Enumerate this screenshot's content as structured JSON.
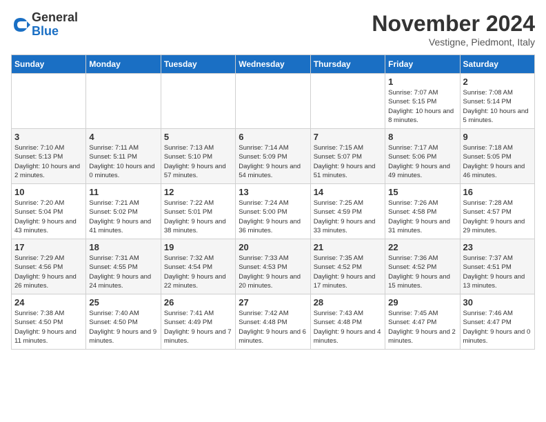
{
  "logo": {
    "general": "General",
    "blue": "Blue"
  },
  "title": "November 2024",
  "subtitle": "Vestigne, Piedmont, Italy",
  "days_of_week": [
    "Sunday",
    "Monday",
    "Tuesday",
    "Wednesday",
    "Thursday",
    "Friday",
    "Saturday"
  ],
  "weeks": [
    [
      {
        "day": "",
        "info": ""
      },
      {
        "day": "",
        "info": ""
      },
      {
        "day": "",
        "info": ""
      },
      {
        "day": "",
        "info": ""
      },
      {
        "day": "",
        "info": ""
      },
      {
        "day": "1",
        "info": "Sunrise: 7:07 AM\nSunset: 5:15 PM\nDaylight: 10 hours and 8 minutes."
      },
      {
        "day": "2",
        "info": "Sunrise: 7:08 AM\nSunset: 5:14 PM\nDaylight: 10 hours and 5 minutes."
      }
    ],
    [
      {
        "day": "3",
        "info": "Sunrise: 7:10 AM\nSunset: 5:13 PM\nDaylight: 10 hours and 2 minutes."
      },
      {
        "day": "4",
        "info": "Sunrise: 7:11 AM\nSunset: 5:11 PM\nDaylight: 10 hours and 0 minutes."
      },
      {
        "day": "5",
        "info": "Sunrise: 7:13 AM\nSunset: 5:10 PM\nDaylight: 9 hours and 57 minutes."
      },
      {
        "day": "6",
        "info": "Sunrise: 7:14 AM\nSunset: 5:09 PM\nDaylight: 9 hours and 54 minutes."
      },
      {
        "day": "7",
        "info": "Sunrise: 7:15 AM\nSunset: 5:07 PM\nDaylight: 9 hours and 51 minutes."
      },
      {
        "day": "8",
        "info": "Sunrise: 7:17 AM\nSunset: 5:06 PM\nDaylight: 9 hours and 49 minutes."
      },
      {
        "day": "9",
        "info": "Sunrise: 7:18 AM\nSunset: 5:05 PM\nDaylight: 9 hours and 46 minutes."
      }
    ],
    [
      {
        "day": "10",
        "info": "Sunrise: 7:20 AM\nSunset: 5:04 PM\nDaylight: 9 hours and 43 minutes."
      },
      {
        "day": "11",
        "info": "Sunrise: 7:21 AM\nSunset: 5:02 PM\nDaylight: 9 hours and 41 minutes."
      },
      {
        "day": "12",
        "info": "Sunrise: 7:22 AM\nSunset: 5:01 PM\nDaylight: 9 hours and 38 minutes."
      },
      {
        "day": "13",
        "info": "Sunrise: 7:24 AM\nSunset: 5:00 PM\nDaylight: 9 hours and 36 minutes."
      },
      {
        "day": "14",
        "info": "Sunrise: 7:25 AM\nSunset: 4:59 PM\nDaylight: 9 hours and 33 minutes."
      },
      {
        "day": "15",
        "info": "Sunrise: 7:26 AM\nSunset: 4:58 PM\nDaylight: 9 hours and 31 minutes."
      },
      {
        "day": "16",
        "info": "Sunrise: 7:28 AM\nSunset: 4:57 PM\nDaylight: 9 hours and 29 minutes."
      }
    ],
    [
      {
        "day": "17",
        "info": "Sunrise: 7:29 AM\nSunset: 4:56 PM\nDaylight: 9 hours and 26 minutes."
      },
      {
        "day": "18",
        "info": "Sunrise: 7:31 AM\nSunset: 4:55 PM\nDaylight: 9 hours and 24 minutes."
      },
      {
        "day": "19",
        "info": "Sunrise: 7:32 AM\nSunset: 4:54 PM\nDaylight: 9 hours and 22 minutes."
      },
      {
        "day": "20",
        "info": "Sunrise: 7:33 AM\nSunset: 4:53 PM\nDaylight: 9 hours and 20 minutes."
      },
      {
        "day": "21",
        "info": "Sunrise: 7:35 AM\nSunset: 4:52 PM\nDaylight: 9 hours and 17 minutes."
      },
      {
        "day": "22",
        "info": "Sunrise: 7:36 AM\nSunset: 4:52 PM\nDaylight: 9 hours and 15 minutes."
      },
      {
        "day": "23",
        "info": "Sunrise: 7:37 AM\nSunset: 4:51 PM\nDaylight: 9 hours and 13 minutes."
      }
    ],
    [
      {
        "day": "24",
        "info": "Sunrise: 7:38 AM\nSunset: 4:50 PM\nDaylight: 9 hours and 11 minutes."
      },
      {
        "day": "25",
        "info": "Sunrise: 7:40 AM\nSunset: 4:50 PM\nDaylight: 9 hours and 9 minutes."
      },
      {
        "day": "26",
        "info": "Sunrise: 7:41 AM\nSunset: 4:49 PM\nDaylight: 9 hours and 7 minutes."
      },
      {
        "day": "27",
        "info": "Sunrise: 7:42 AM\nSunset: 4:48 PM\nDaylight: 9 hours and 6 minutes."
      },
      {
        "day": "28",
        "info": "Sunrise: 7:43 AM\nSunset: 4:48 PM\nDaylight: 9 hours and 4 minutes."
      },
      {
        "day": "29",
        "info": "Sunrise: 7:45 AM\nSunset: 4:47 PM\nDaylight: 9 hours and 2 minutes."
      },
      {
        "day": "30",
        "info": "Sunrise: 7:46 AM\nSunset: 4:47 PM\nDaylight: 9 hours and 0 minutes."
      }
    ]
  ]
}
